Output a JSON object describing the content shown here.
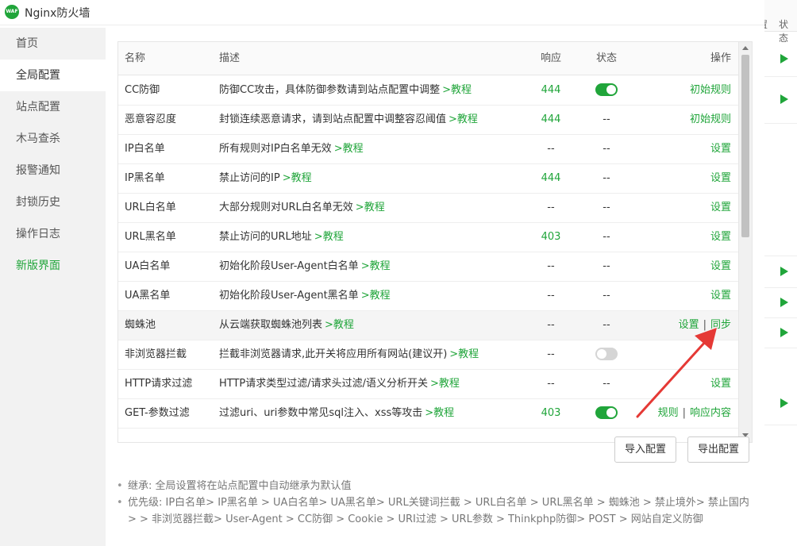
{
  "window": {
    "title": "Nginx防火墙",
    "logo_text": "WAF"
  },
  "background": {
    "tab1": "置",
    "tab2": "状态"
  },
  "sidebar": {
    "items": [
      {
        "label": "首页"
      },
      {
        "label": "全局配置"
      },
      {
        "label": "站点配置"
      },
      {
        "label": "木马查杀"
      },
      {
        "label": "报警通知"
      },
      {
        "label": "封锁历史"
      },
      {
        "label": "操作日志"
      },
      {
        "label": "新版界面"
      }
    ]
  },
  "table": {
    "headers": {
      "name": "名称",
      "desc": "描述",
      "response": "响应",
      "state": "状态",
      "op": "操作"
    },
    "rows": [
      {
        "name": "CC防御",
        "desc": "防御CC攻击，具体防御参数请到站点配置中调整",
        "link": ">教程",
        "response": "444",
        "state": "on",
        "ops": [
          "初始规则"
        ]
      },
      {
        "name": "恶意容忍度",
        "desc": "封锁连续恶意请求，请到站点配置中调整容忍阈值",
        "link": ">教程",
        "response": "444",
        "state": "--",
        "ops": [
          "初始规则"
        ]
      },
      {
        "name": "IP白名单",
        "desc": "所有规则对IP白名单无效",
        "link": ">教程",
        "response": "--",
        "state": "--",
        "ops": [
          "设置"
        ]
      },
      {
        "name": "IP黑名单",
        "desc": "禁止访问的IP",
        "link": ">教程",
        "response": "444",
        "state": "--",
        "ops": [
          "设置"
        ]
      },
      {
        "name": "URL白名单",
        "desc": "大部分规则对URL白名单无效",
        "link": ">教程",
        "response": "--",
        "state": "--",
        "ops": [
          "设置"
        ]
      },
      {
        "name": "URL黑名单",
        "desc": "禁止访问的URL地址",
        "link": ">教程",
        "response": "403",
        "state": "--",
        "ops": [
          "设置"
        ]
      },
      {
        "name": "UA白名单",
        "desc": "初始化阶段User-Agent白名单",
        "link": ">教程",
        "response": "--",
        "state": "--",
        "ops": [
          "设置"
        ]
      },
      {
        "name": "UA黑名单",
        "desc": "初始化阶段User-Agent黑名单",
        "link": ">教程",
        "response": "--",
        "state": "--",
        "ops": [
          "设置"
        ]
      },
      {
        "name": "蜘蛛池",
        "desc": "从云端获取蜘蛛池列表",
        "link": ">教程",
        "response": "--",
        "state": "--",
        "ops": [
          "设置",
          "同步"
        ]
      },
      {
        "name": "非浏览器拦截",
        "desc": "拦截非浏览器请求,此开关将应用所有网站(建议开)",
        "link": ">教程",
        "response": "--",
        "state": "off",
        "ops": []
      },
      {
        "name": "HTTP请求过滤",
        "desc": "HTTP请求类型过滤/请求头过滤/语义分析开关",
        "link": ">教程",
        "response": "--",
        "state": "--",
        "ops": [
          "设置"
        ]
      },
      {
        "name": "GET-参数过滤",
        "desc": "过滤uri、uri参数中常见sql注入、xss等攻击",
        "link": ">教程",
        "response": "403",
        "state": "on",
        "ops": [
          "规则",
          "响应内容"
        ]
      }
    ]
  },
  "buttons": {
    "import": "导入配置",
    "export": "导出配置"
  },
  "notes": [
    "继承: 全局设置将在站点配置中自动继承为默认值",
    "优先级: IP白名单> IP黑名单 > UA白名单> UA黑名单> URL关键词拦截 > URL白名单 > URL黑名单 > 蜘蛛池 > 禁止境外> 禁止国内> > 非浏览器拦截> User-Agent > CC防御 > Cookie > URI过滤 > URL参数 > Thinkphp防御> POST > 网站自定义防御"
  ],
  "colors": {
    "accent": "#20a53a",
    "annotation_arrow": "#e53935"
  }
}
